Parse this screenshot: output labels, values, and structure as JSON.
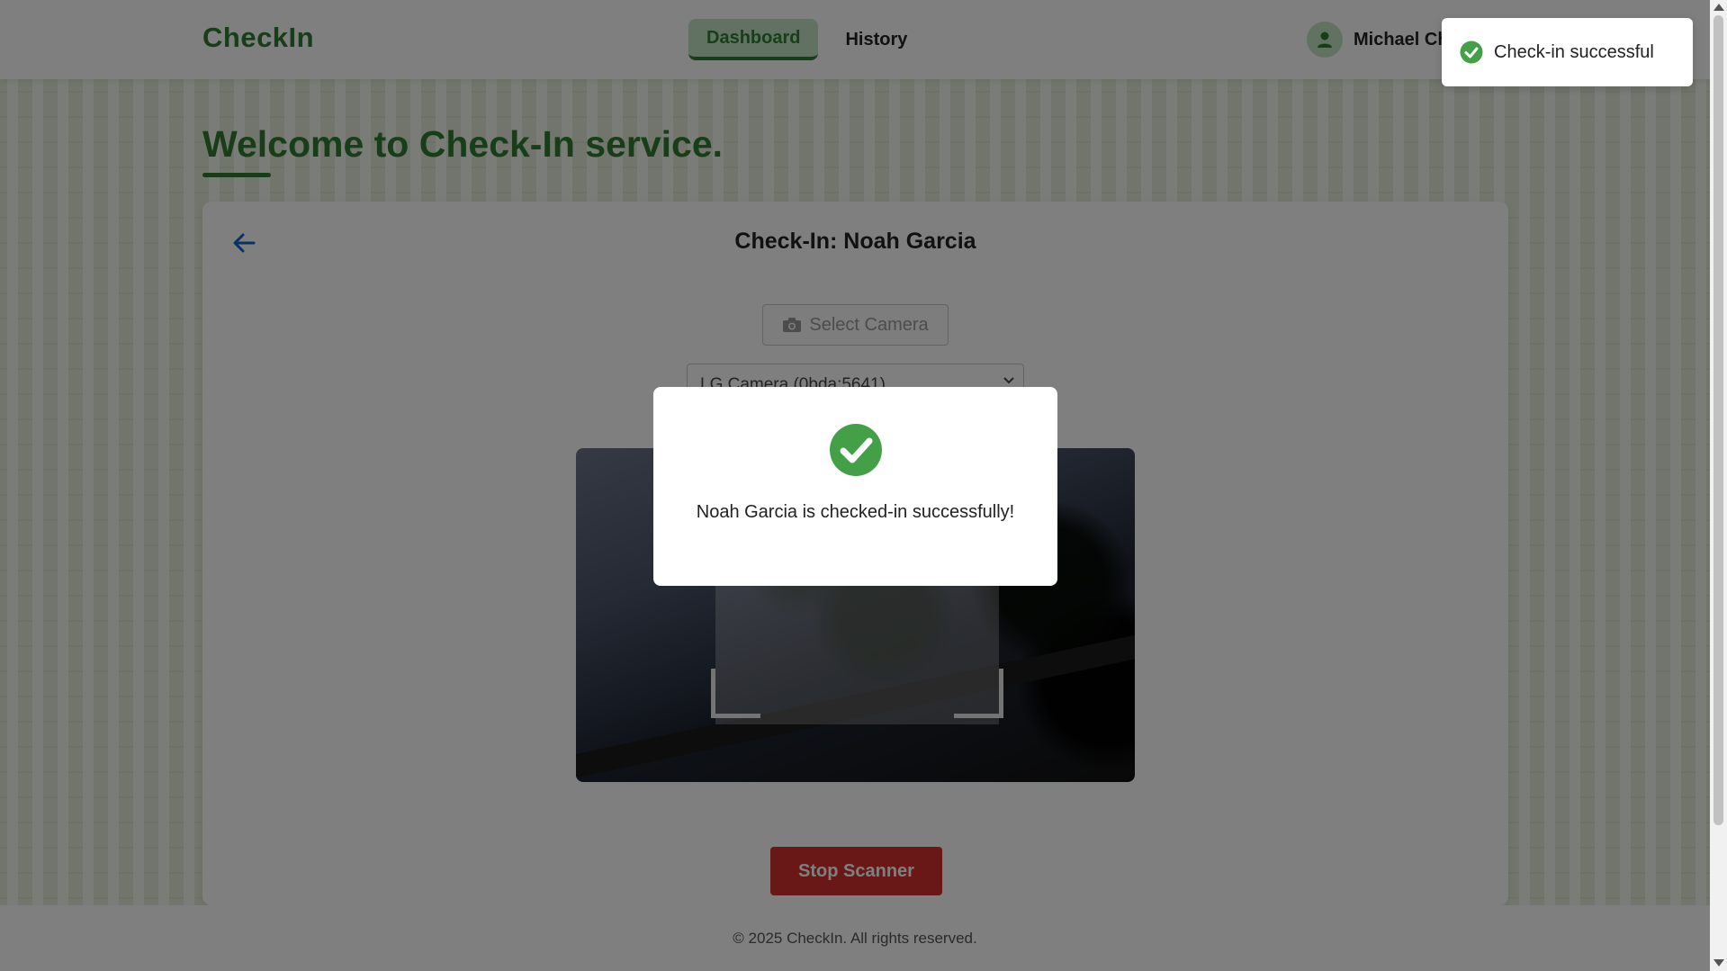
{
  "header": {
    "brand": "CheckIn",
    "nav": [
      {
        "label": "Dashboard",
        "active": true
      },
      {
        "label": "History",
        "active": false
      }
    ],
    "user_name": "Michael Ch",
    "icon": "user-icon"
  },
  "page": {
    "title": "Welcome to Check-In service."
  },
  "card": {
    "title": "Check-In: Noah Garcia",
    "back_icon": "arrow-left-icon",
    "select_camera_label": "Select Camera",
    "camera_selected": "LG Camera (0bda:5641)",
    "stop_button_label": "Stop Scanner"
  },
  "modal": {
    "message": "Noah Garcia is checked-in successfully!",
    "icon": "check-circle-icon"
  },
  "toast": {
    "message": "Check-in successful",
    "icon": "check-circle-icon"
  },
  "footer": {
    "text": "© 2025 CheckIn. All rights reserved."
  },
  "colors": {
    "brand": "#2e7d32",
    "nav_active_bg": "#c5e5c5",
    "danger": "#d32f2f",
    "success": "#43a047"
  }
}
